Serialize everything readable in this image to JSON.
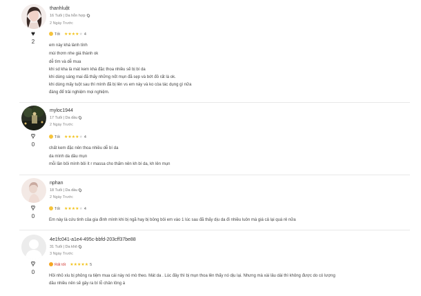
{
  "reviews": [
    {
      "username": "thanhluật",
      "meta": "16 Tuổi | Da hỗn hợp",
      "date": "2 Ngày Trước",
      "likes": "2",
      "liked": true,
      "rating_label": "Tốt",
      "stars": 4,
      "rating_value": "4",
      "lines": [
        "em này khá lành tính",
        "mùi thơm nhe giá thành ok",
        "dễ tìm và dễ mua",
        "khi sd kha là mát kem khá đặc thoa nhiều sẽ bị bí da",
        "khi dùng sáng mai đã thấy những nốt mụn đã sẹp và bớt đỏ rất là ok.",
        "khi dùng mấy tuột sau thì mình đã bị lên vs em này và ko còa tác dụng gì nữa",
        "đáng để trải nghiệm mọi nghiệm."
      ]
    },
    {
      "username": "myloc1944",
      "meta": "17 Tuổi | Da dầu",
      "date": "2 Ngày Trước",
      "likes": "0",
      "liked": false,
      "rating_label": "Tốt",
      "stars": 4,
      "rating_value": "4",
      "lines": [
        "chất kem đặc nên thoa nhiều dễ bí da",
        "da mình da dầu mụn",
        "mỗi lần bôi mình bôi ít r massa cho thấm nên kh bí da, kh lên mụn"
      ]
    },
    {
      "username": "nphan",
      "meta": "18 Tuổi | Da dầu",
      "date": "2 Ngày Trước",
      "likes": "0",
      "liked": false,
      "rating_label": "Tốt",
      "stars": 4,
      "rating_value": "4",
      "lines": [
        "Em này là cứu tinh của gia đình mình khi bị ngã hay bị bỏng bôi em vào 1 lúc sau đã thấy dịu da đi nhiều luôn mà giá cả lại quá rẻ nữa"
      ]
    },
    {
      "username": "4e1fc041-a1e4-495c-bbfd-203cff37be88",
      "meta": "31 Tuổi | Da khô",
      "date": "3 Ngày Trước",
      "likes": "0",
      "liked": false,
      "rating_label": "Rất tốt",
      "stars": 5,
      "rating_value": "5",
      "lines": [
        "Hồi nhỏ xíu bị phỏng ra tiệm mua cái này nó mò theo. Mát da . Lúc đây thì bị mụn thoa lên thấy nó dịu lại. Nhưng mà xài lâu dài thì không được do có lượng",
        "dầu nhiều nên sẽ gây ra bí lỗ chân lông á"
      ]
    }
  ]
}
